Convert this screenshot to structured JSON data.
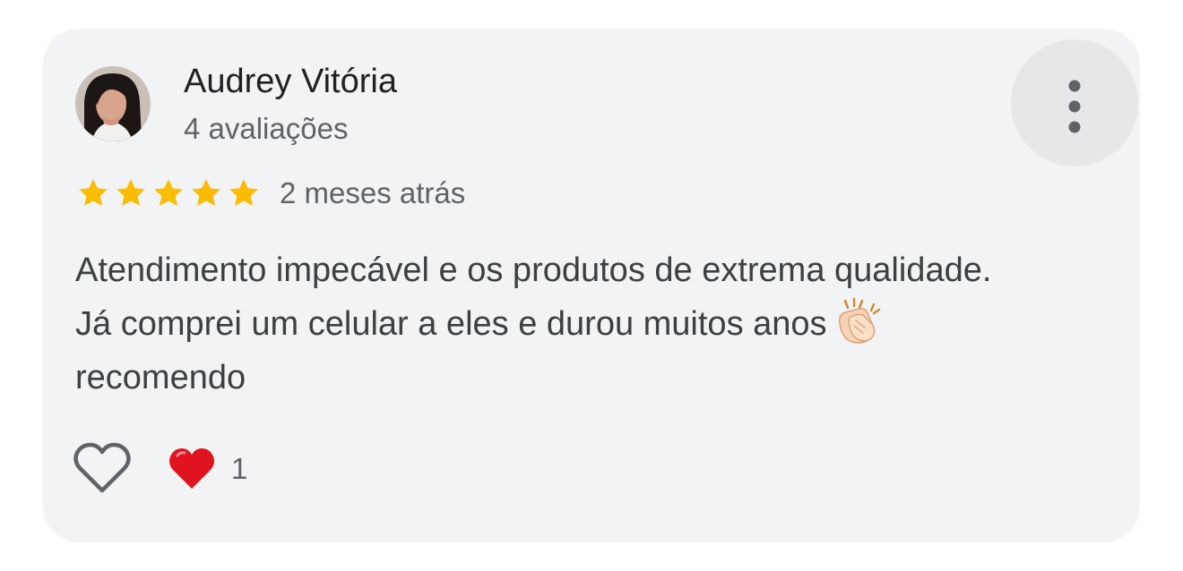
{
  "review": {
    "author_name": "Audrey Vitória",
    "author_reviews": "4 avaliações",
    "rating": 5,
    "rating_max": 5,
    "time": "2 meses atrás",
    "text_lines": [
      "Atendimento impecável e os produtos de extrema qualidade.",
      "Já comprei um celular a eles e durou muitos anos",
      "recomendo"
    ],
    "reaction_count": "1"
  },
  "icons": {
    "avatar": "avatar",
    "more": "more-vertical-icon",
    "star": "star-icon",
    "clap": "clapping-hands-icon",
    "like": "heart-outline-icon",
    "reaction": "red-heart-icon"
  },
  "colors": {
    "card_background": "#f1f3f4",
    "star": "#fbbc04",
    "heart": "#e0141e",
    "primary_text": "#202124",
    "secondary_text": "#5f6368"
  }
}
